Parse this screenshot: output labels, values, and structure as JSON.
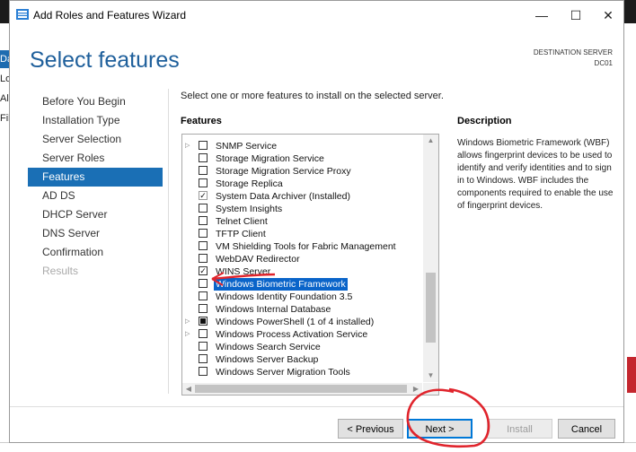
{
  "window": {
    "title": "Add Roles and Features Wizard",
    "minimize": "—",
    "maximize": "☐",
    "close": "✕"
  },
  "header": {
    "title": "Select features",
    "destination_label": "DESTINATION SERVER",
    "destination_server": "DC01"
  },
  "nav": [
    {
      "label": "Before You Begin",
      "state": "normal"
    },
    {
      "label": "Installation Type",
      "state": "normal"
    },
    {
      "label": "Server Selection",
      "state": "normal"
    },
    {
      "label": "Server Roles",
      "state": "normal"
    },
    {
      "label": "Features",
      "state": "active"
    },
    {
      "label": "AD DS",
      "state": "normal"
    },
    {
      "label": "DHCP Server",
      "state": "normal"
    },
    {
      "label": "DNS Server",
      "state": "normal"
    },
    {
      "label": "Confirmation",
      "state": "normal"
    },
    {
      "label": "Results",
      "state": "disabled"
    }
  ],
  "main": {
    "instruction": "Select one or more features to install on the selected server.",
    "features_header": "Features",
    "description_header": "Description",
    "description": "Windows Biometric Framework (WBF) allows fingerprint devices to be used to identify and verify identities and to sign in to Windows. WBF includes the components required to enable the use of fingerprint devices."
  },
  "features": [
    {
      "label": "SNMP Service",
      "state": "unchecked",
      "expandable": true,
      "selected": false
    },
    {
      "label": "Storage Migration Service",
      "state": "unchecked",
      "expandable": false,
      "selected": false
    },
    {
      "label": "Storage Migration Service Proxy",
      "state": "unchecked",
      "expandable": false,
      "selected": false
    },
    {
      "label": "Storage Replica",
      "state": "unchecked",
      "expandable": false,
      "selected": false
    },
    {
      "label": "System Data Archiver (Installed)",
      "state": "checked-disabled",
      "expandable": false,
      "selected": false
    },
    {
      "label": "System Insights",
      "state": "unchecked",
      "expandable": false,
      "selected": false
    },
    {
      "label": "Telnet Client",
      "state": "unchecked",
      "expandable": false,
      "selected": false
    },
    {
      "label": "TFTP Client",
      "state": "unchecked",
      "expandable": false,
      "selected": false
    },
    {
      "label": "VM Shielding Tools for Fabric Management",
      "state": "unchecked",
      "expandable": false,
      "selected": false
    },
    {
      "label": "WebDAV Redirector",
      "state": "unchecked",
      "expandable": false,
      "selected": false
    },
    {
      "label": "WINS Server",
      "state": "checked",
      "expandable": false,
      "selected": false
    },
    {
      "label": "Windows Biometric Framework",
      "state": "unchecked",
      "expandable": false,
      "selected": true
    },
    {
      "label": "Windows Identity Foundation 3.5",
      "state": "unchecked",
      "expandable": false,
      "selected": false
    },
    {
      "label": "Windows Internal Database",
      "state": "unchecked",
      "expandable": false,
      "selected": false
    },
    {
      "label": "Windows PowerShell (1 of 4 installed)",
      "state": "partial",
      "expandable": true,
      "selected": false
    },
    {
      "label": "Windows Process Activation Service",
      "state": "unchecked",
      "expandable": true,
      "selected": false
    },
    {
      "label": "Windows Search Service",
      "state": "unchecked",
      "expandable": false,
      "selected": false
    },
    {
      "label": "Windows Server Backup",
      "state": "unchecked",
      "expandable": false,
      "selected": false
    },
    {
      "label": "Windows Server Migration Tools",
      "state": "unchecked",
      "expandable": false,
      "selected": false
    }
  ],
  "buttons": {
    "previous": "< Previous",
    "next": "Next >",
    "install": "Install",
    "cancel": "Cancel"
  },
  "background": {
    "left_fragments": [
      "Das",
      "Loc",
      "All",
      "File"
    ]
  },
  "colors": {
    "accent": "#1a6fb5",
    "selection": "#0a64c9",
    "header_title": "#1e5f9b",
    "annotation_red": "#e0242c"
  }
}
